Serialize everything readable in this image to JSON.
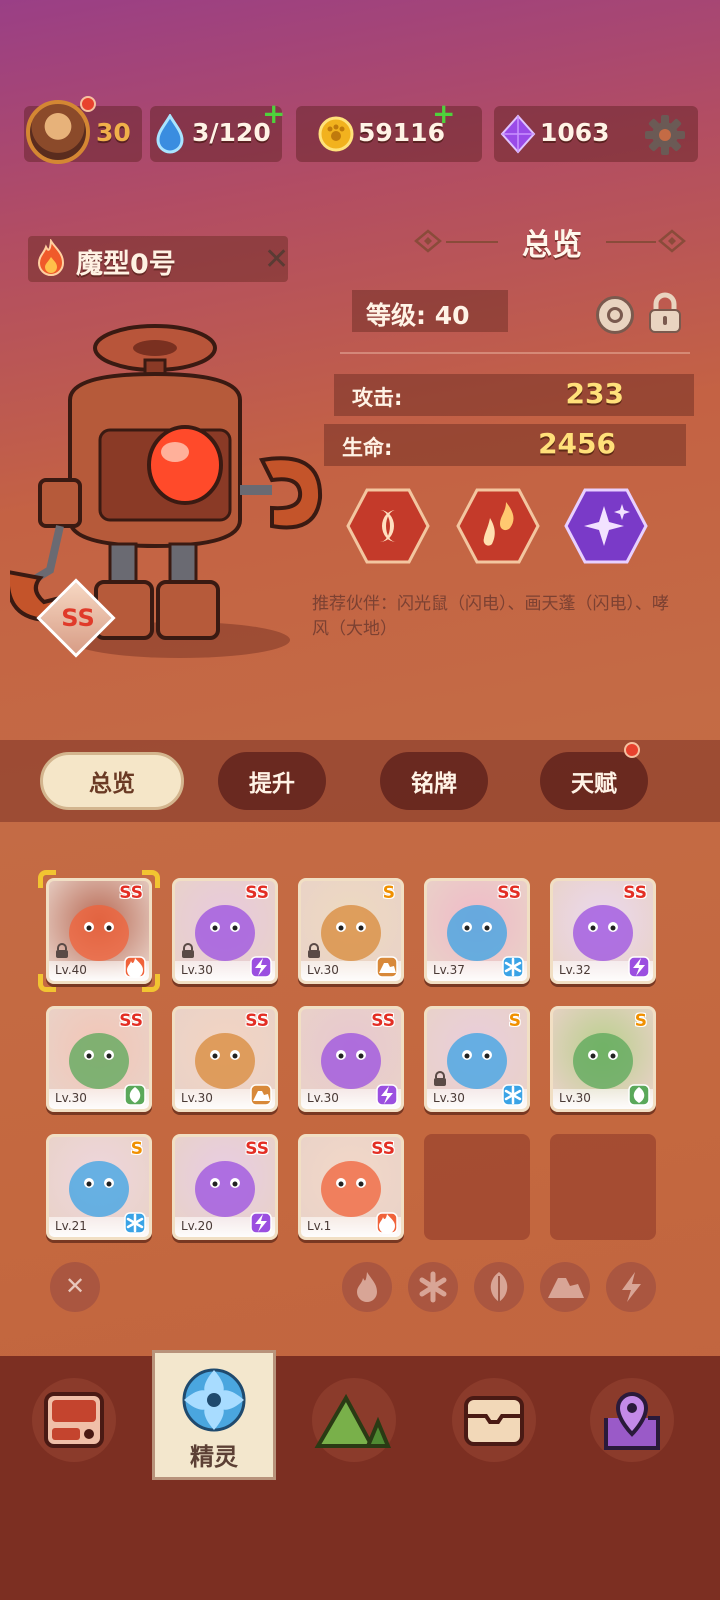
{
  "topbar": {
    "level": "30",
    "energy": "3/120",
    "coins": "59116",
    "gems": "1063"
  },
  "sprite": {
    "name": "魔型0号",
    "grade": "SS",
    "element": "fire-icon"
  },
  "overview": {
    "title": "总览",
    "level_label": "等级: 40",
    "stats": [
      {
        "label": "攻击:",
        "value": "233"
      },
      {
        "label": "生命:",
        "value": "2456"
      }
    ],
    "recommend": "推荐伙伴：闪光鼠（闪电）、画天蓬（闪电）、哮风（大地）"
  },
  "tabs": [
    {
      "label": "总览",
      "active": true
    },
    {
      "label": "提升"
    },
    {
      "label": "铭牌"
    },
    {
      "label": "天赋",
      "badge": true
    }
  ],
  "cards": [
    {
      "grade": "SS",
      "level": "Lv.40",
      "element": "fire",
      "locked": true,
      "selected": true,
      "color": "#b86a55"
    },
    {
      "grade": "SS",
      "level": "Lv.30",
      "element": "lightning",
      "locked": true,
      "color": "#e7c9de"
    },
    {
      "grade": "S",
      "level": "Lv.30",
      "element": "earth",
      "locked": true,
      "color": "#eedac0"
    },
    {
      "grade": "SS",
      "level": "Lv.37",
      "element": "ice",
      "color": "#f0b9c8"
    },
    {
      "grade": "SS",
      "level": "Lv.32",
      "element": "lightning",
      "color": "#ead8ef"
    },
    {
      "grade": "SS",
      "level": "Lv.30",
      "element": "wood",
      "color": "#f3c5b6"
    },
    {
      "grade": "SS",
      "level": "Lv.30",
      "element": "earth",
      "color": "#f3d4c2"
    },
    {
      "grade": "SS",
      "level": "Lv.30",
      "element": "lightning",
      "color": "#e8c7d0"
    },
    {
      "grade": "S",
      "level": "Lv.30",
      "element": "ice",
      "locked": true,
      "color": "#e9cddc"
    },
    {
      "grade": "S",
      "level": "Lv.30",
      "element": "wood",
      "color": "#b9cf8c"
    },
    {
      "grade": "S",
      "level": "Lv.21",
      "element": "ice",
      "color": "#eed6dd"
    },
    {
      "grade": "SS",
      "level": "Lv.20",
      "element": "lightning",
      "color": "#e7cce4"
    },
    {
      "grade": "SS",
      "level": "Lv.1",
      "element": "fire",
      "color": "#f3d8c8"
    }
  ],
  "filters": [
    "clear-filter-icon",
    "fire-filter-icon",
    "ice-filter-icon",
    "wood-filter-icon",
    "earth-filter-icon",
    "lightning-filter-icon"
  ],
  "bottom_nav": [
    {
      "name": "shop-icon"
    },
    {
      "name": "sprite-icon",
      "label": "精灵",
      "active": true
    },
    {
      "name": "mountain-icon"
    },
    {
      "name": "chest-icon"
    },
    {
      "name": "map-pin-icon"
    }
  ],
  "colors": {
    "fire": "#f0623a",
    "ice": "#3aa3e6",
    "wood": "#5aa85a",
    "earth": "#d8893a",
    "lightning": "#9b4fe0"
  }
}
